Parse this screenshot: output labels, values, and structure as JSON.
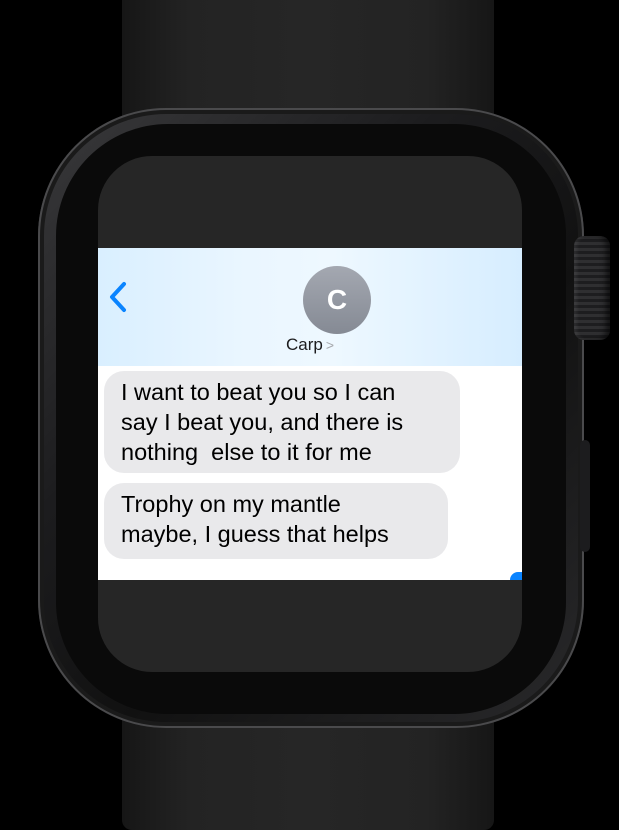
{
  "conversation": {
    "avatar_initial": "C",
    "contact_name": "Carp",
    "contact_chevron": ">",
    "back_icon": "chevron-left-icon"
  },
  "messages": [
    {
      "lines": [
        "I want to beat you so I can",
        "say I beat you, and there is",
        "nothing  else to it for me"
      ]
    },
    {
      "lines": [
        "Trophy on my mantle",
        "maybe, I guess that helps"
      ]
    }
  ],
  "colors": {
    "accent": "#0a84ff",
    "received_bubble": "#e9e9eb",
    "header_tint": "#e3f3ff",
    "avatar": "#9a9ea6"
  }
}
